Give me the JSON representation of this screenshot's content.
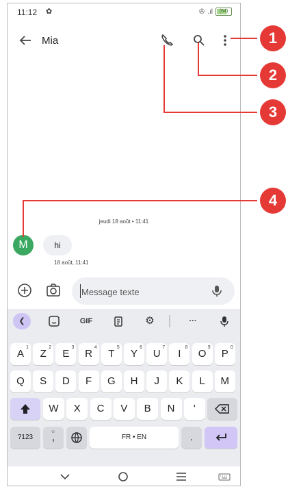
{
  "status": {
    "time": "11:12",
    "battery": "(64)"
  },
  "appbar": {
    "title": "Mia"
  },
  "conversation": {
    "date_chip": "jeudi 18 août • 11:41",
    "avatar_letter": "M",
    "message_text": "hi",
    "message_time": "18 août, 11:41"
  },
  "composer": {
    "placeholder": "Message texte"
  },
  "keyboard": {
    "toolbar": {
      "gif": "GIF",
      "ellipsis": "···"
    },
    "row1": [
      {
        "k": "A",
        "n": "1"
      },
      {
        "k": "Z",
        "n": "2"
      },
      {
        "k": "E",
        "n": "3"
      },
      {
        "k": "R",
        "n": "4"
      },
      {
        "k": "T",
        "n": "5"
      },
      {
        "k": "Y",
        "n": "6"
      },
      {
        "k": "U",
        "n": "7"
      },
      {
        "k": "I",
        "n": "8"
      },
      {
        "k": "O",
        "n": "9"
      },
      {
        "k": "P",
        "n": "0"
      }
    ],
    "row2": [
      "Q",
      "S",
      "D",
      "F",
      "G",
      "H",
      "J",
      "K",
      "L",
      "M"
    ],
    "row3": [
      "W",
      "X",
      "C",
      "V",
      "B",
      "N",
      "'"
    ],
    "symbols_key": "?123",
    "comma_key": ",",
    "space_key": "FR • EN",
    "period_key": "."
  },
  "callouts": [
    "1",
    "2",
    "3",
    "4"
  ],
  "colors": {
    "accent": "#cfc5f5",
    "badge": "#e53935",
    "avatar": "#3aa860"
  }
}
